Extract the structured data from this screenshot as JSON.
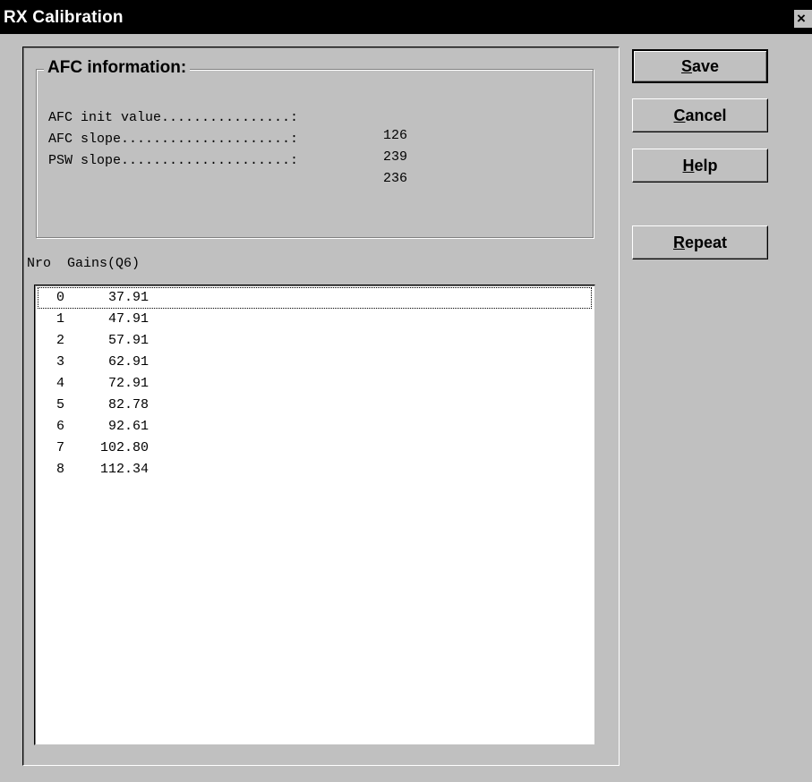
{
  "window": {
    "title": "RX Calibration",
    "close_label": "×"
  },
  "afc": {
    "group_title": "AFC information:",
    "rows": [
      {
        "label": "AFC init value................:",
        "value": "126"
      },
      {
        "label": "AFC slope.....................:",
        "value": "239"
      },
      {
        "label": "PSW slope.....................:",
        "value": "236"
      }
    ]
  },
  "gains": {
    "header": "Nro  Gains(Q6)",
    "rows": [
      {
        "nro": "0",
        "gain": "37.91"
      },
      {
        "nro": "1",
        "gain": "47.91"
      },
      {
        "nro": "2",
        "gain": "57.91"
      },
      {
        "nro": "3",
        "gain": "62.91"
      },
      {
        "nro": "4",
        "gain": "72.91"
      },
      {
        "nro": "5",
        "gain": "82.78"
      },
      {
        "nro": "6",
        "gain": "92.61"
      },
      {
        "nro": "7",
        "gain": "102.80"
      },
      {
        "nro": "8",
        "gain": "112.34"
      }
    ],
    "focused_index": 0
  },
  "buttons": {
    "save": {
      "accel": "S",
      "rest": "ave"
    },
    "cancel": {
      "accel": "C",
      "rest": "ancel"
    },
    "help": {
      "accel": "H",
      "rest": "elp"
    },
    "repeat": {
      "accel": "R",
      "rest": "epeat"
    }
  },
  "colors": {
    "dialog_bg": "#c0c0c0",
    "titlebar_bg": "#000000",
    "list_bg": "#ffffff"
  }
}
